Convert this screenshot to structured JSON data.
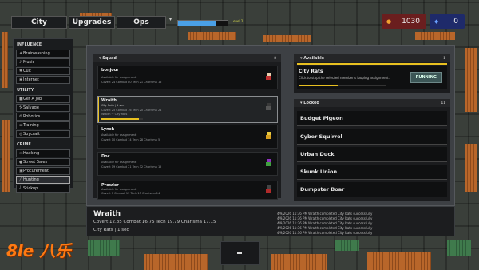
{
  "topbar": {
    "tabs": [
      "City",
      "Upgrades",
      "Ops"
    ],
    "dropdown_icon": "chevron-down-icon",
    "level_label": "Level 2",
    "level_progress": 0.78,
    "money": "1030",
    "money_color": "#6a1e1e",
    "heat": "0",
    "heat_color": "#1e2a6a"
  },
  "sidebar": {
    "sections": [
      {
        "heading": "INFLUENCE",
        "items": [
          "Brainwashing",
          "Music",
          "Cult",
          "Internet"
        ]
      },
      {
        "heading": "UTILITY",
        "items": [
          "Get A Job",
          "Salvage",
          "Robotics",
          "Training",
          "Spycraft"
        ]
      },
      {
        "heading": "CRIME",
        "items": [
          "Hacking",
          "Street Sales",
          "Procurement",
          "Hunting",
          "Stickup"
        ]
      }
    ],
    "selected": "Hunting"
  },
  "squad": {
    "title": "Squad",
    "count": "8",
    "members": [
      {
        "name": "bonjour",
        "status": "Available for assignment",
        "stats": "Covert 24  Combat 80  Tech 21  Charisma 16"
      },
      {
        "name": "Wraith",
        "status": "City Rats  |  1 sec",
        "stats": "Covert 25  Combat 16  Tech 20  Charisma 24",
        "extra": "Wraith → City Rats",
        "progress": 0.9,
        "selected": true
      },
      {
        "name": "Lynch",
        "status": "Available for assignment",
        "stats": "Covert 10  Combat 14  Tech 28  Charisma 5"
      },
      {
        "name": "Doc",
        "status": "Available for assignment",
        "stats": "Covert 19  Combat 21  Tech 32  Charisma 15"
      },
      {
        "name": "Prowler",
        "status": "Available for assignment",
        "stats": "Covert 7  Combat 13  Tech 15  Charisma 14"
      }
    ]
  },
  "available": {
    "title": "Available",
    "count": "1",
    "job_name": "City Rats",
    "job_hint": "Click to stop the selected member's looping assignment.",
    "button": "RUNNING",
    "progress": 0.45
  },
  "locked": {
    "title": "Locked",
    "count": "11",
    "items": [
      "Budget Pigeon",
      "Cyber Squirrel",
      "Urban Duck",
      "Skunk Union",
      "Dumpster Boar"
    ]
  },
  "detail": {
    "name": "Wraith",
    "stats": "Covert 12.85  Combat 16.75  Tech 19.79  Charisma 17.15",
    "assignment": "City Rats  |  1 sec",
    "log": [
      "4/9/2026 11:36 PM    Wraith completed City Rats successfully",
      "4/9/2026 11:36 PM    Wraith completed City Rats successfully",
      "4/9/2026 11:36 PM    Wraith completed City Rats successfully",
      "4/9/2026 11:36 PM    Wraith completed City Rats successfully",
      "4/9/2026 11:36 PM    Wraith completed City Rats successfully"
    ]
  },
  "bottom_button": "minus-icon",
  "watermark": "8le 八乐"
}
